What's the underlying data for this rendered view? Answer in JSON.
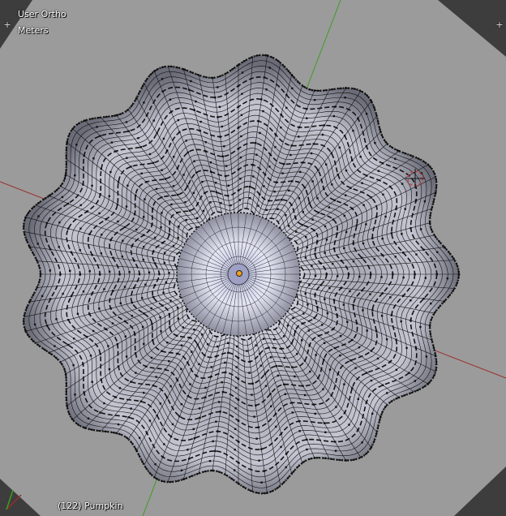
{
  "viewport": {
    "view_name": "User Ortho",
    "units": "Meters",
    "object_info": "(122) Pumpkin",
    "corner_tl_glyph": "+",
    "corner_tr_glyph": "+"
  },
  "colors": {
    "background_outer": "#3d3d3d",
    "floor_plane": "#9b9b9b",
    "x_axis": "#9c2b2b",
    "y_axis": "#3f9c1f",
    "mesh_fill": "#c9cbd6",
    "mesh_shadow": "#5a5b66",
    "wire": "#121212",
    "origin_dot": "#f0a020",
    "cursor_red": "#d23a3a"
  },
  "mesh": {
    "lobes": 13,
    "rings": 28,
    "spokes": 96
  }
}
